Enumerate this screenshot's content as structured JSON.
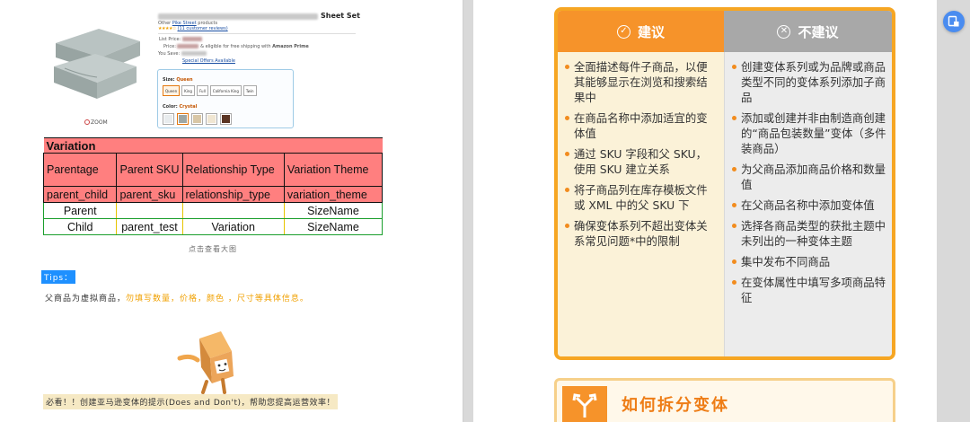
{
  "left_page": {
    "product": {
      "title_suffix": "Sheet Set",
      "other_label": "Other",
      "brand": "Pike Street",
      "products_word": "products",
      "reviews": "(11 customer reviews)",
      "list_price_label": "List Price:",
      "price_label": "Price:",
      "shipping": "& eligible for free shipping with",
      "prime": "Amazon Prime",
      "you_save_label": "You Save:",
      "special_offers": "Special Offers Available",
      "size_label": "Size:",
      "size_selected": "Queen",
      "sizes": [
        "Queen",
        "King",
        "Full",
        "California King",
        "Twin"
      ],
      "color_label": "Color:",
      "color_selected": "Crystal",
      "swatch_colors": [
        "#e8ecee",
        "#9da7a5",
        "#d9c7a6",
        "#f0e6d2",
        "#5a3423"
      ],
      "zoom": "ZOOM"
    },
    "variation_table": {
      "title": "Variation",
      "columns": [
        "Parentage",
        "Parent SKU",
        "Relationship Type",
        "Variation Theme"
      ],
      "keys": [
        "parent_child",
        "parent_sku",
        "relationship_type",
        "variation_theme"
      ],
      "rows": [
        [
          "Parent",
          "",
          "",
          "SizeName"
        ],
        [
          "Child",
          "parent_test",
          "Variation",
          "SizeName"
        ]
      ]
    },
    "caption": "点击查看大图",
    "tips_label": "Tips：",
    "note_prefix": "父商品为虚拟商品，",
    "note_highlight": "勿填写数量，价格，颜色 ，尺寸等具体信息。",
    "banner": "必看！！创建亚马逊变体的提示(Does and Don't)，帮助您提高运营效率！"
  },
  "right_page": {
    "do_title": "建议",
    "dont_title": "不建议",
    "do_items": [
      "全面描述每件子商品，以便其能够显示在浏览和搜索结果中",
      "在商品名称中添加适宜的变体值",
      "通过 SKU 字段和父 SKU，使用 SKU 建立关系",
      "将子商品列在库存模板文件或 XML 中的父 SKU 下",
      "确保变体系列不超出变体关系常见问题*中的限制"
    ],
    "dont_items": [
      "创建变体系列或为品牌或商品类型不同的变体系列添加子商品",
      "添加或创建并非由制造商创建的“商品包装数量”变体（多件装商品）",
      "为父商品添加商品价格和数量值",
      "在父商品名称中添加变体值",
      "选择各商品类型的获批主题中未列出的一种变体主题",
      "集中发布不同商品",
      "在变体属性中填写多项商品特征"
    ],
    "section_title": "如何拆分变体"
  },
  "colors": {
    "accent_orange": "#f6932a",
    "table_red": "#ff7f7f",
    "tips_blue": "#1e90ff",
    "fab_blue": "#4a8cf0"
  }
}
